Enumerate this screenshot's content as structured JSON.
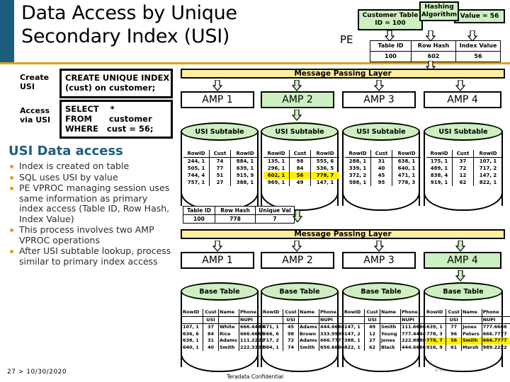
{
  "slide": {
    "title": "Data Access by Unique Secondary Index (USI)",
    "footer_number": "27",
    "footer_sep": ">",
    "footer_date": "10/30/2020",
    "confidential": "Teradata Confidential",
    "watermark": "Teradata",
    "watermark_sub": "a division of NCR"
  },
  "left": {
    "create_label_l1": "Create",
    "create_label_l2": "USI",
    "create_sql_l1": "CREATE UNIQUE INDEX",
    "create_sql_l2": "(cust) on customer;",
    "access_label_l1": "Access",
    "access_label_l2": "via USI",
    "access_sql_l1": "SELECT    *",
    "access_sql_l2": "FROM      customer",
    "access_sql_l3": "WHERE   cust = 56;",
    "heading": "USI Data access",
    "bullets": [
      "Index is created on table",
      "SQL uses USI by value",
      "PE VPROC managing session uses same information as primary index access (Table ID, Row Hash, Index Value)",
      "This process involves two AMP VPROC operations",
      "After USI subtable lookup, process similar to primary index access"
    ]
  },
  "pe": {
    "label": "PE",
    "customer_table_l1": "Customer Table",
    "customer_table_l2": "ID = 100",
    "hashing_l1": "Hashing",
    "hashing_l2": "Algorithm",
    "value_box": "Value = 56",
    "headers": [
      "Table ID",
      "Row Hash",
      "Index Value"
    ],
    "values": [
      "100",
      "602",
      "56"
    ]
  },
  "mpl": {
    "top_label": "Message Passing Layer",
    "bottom_label": "Message Passing Layer"
  },
  "amps_top": [
    {
      "label": "AMP 1",
      "highlighted": false
    },
    {
      "label": "AMP 2",
      "highlighted": true
    },
    {
      "label": "AMP 3",
      "highlighted": false
    },
    {
      "label": "AMP 4",
      "highlighted": false
    }
  ],
  "amps_bottom": [
    {
      "label": "AMP 1",
      "highlighted": false
    },
    {
      "label": "AMP 2",
      "highlighted": false
    },
    {
      "label": "AMP 3",
      "highlighted": false
    },
    {
      "label": "AMP 4",
      "highlighted": true
    }
  ],
  "usi_subtables": {
    "title": "USI Subtable",
    "headers": [
      "RowID",
      "Cust",
      "RowID"
    ],
    "amp1": [
      [
        "244, 1",
        "74",
        "884, 1"
      ],
      [
        "505, 1",
        "77",
        "639, 1"
      ],
      [
        "744, 4",
        "51",
        "915, 9"
      ],
      [
        "757, 1",
        "27",
        "388, 1"
      ]
    ],
    "amp2": [
      [
        "135, 1",
        "98",
        "555, 6"
      ],
      [
        "296, 1",
        "84",
        "536, 5"
      ],
      [
        "602, 1",
        "56",
        "778, 7"
      ],
      [
        "969, 1",
        "49",
        "147, 1"
      ]
    ],
    "amp2_highlight_row": 2,
    "amp3": [
      [
        "288, 1",
        "31",
        "638, 1"
      ],
      [
        "339, 1",
        "40",
        "640, 1"
      ],
      [
        "372, 2",
        "45",
        "471, 1"
      ],
      [
        "588, 1",
        "95",
        "778, 3"
      ]
    ],
    "amp4": [
      [
        "175, 1",
        "37",
        "107, 1"
      ],
      [
        "489, 1",
        "72",
        "717, 2"
      ],
      [
        "838, 4",
        "12",
        "147, 2"
      ],
      [
        "919, 1",
        "62",
        "822, 1"
      ]
    ]
  },
  "lookup_result": {
    "headers": [
      "Table ID",
      "Row Hash",
      "Unique Val"
    ],
    "values": [
      "100",
      "778",
      "7"
    ]
  },
  "base_tables": {
    "title": "Base Table",
    "headers": [
      "RowID",
      "Cust",
      "Name",
      "Phone"
    ],
    "subheaders": [
      "",
      "USI",
      "",
      "NUPI"
    ],
    "amp1": [
      [
        "107, 1",
        "37",
        "White",
        "666.4444"
      ],
      [
        "636, 6",
        "84",
        "Rice",
        "666.6666"
      ],
      [
        "638, 1",
        "31",
        "Adams",
        "111.2222"
      ],
      [
        "640, 1",
        "40",
        "Smith",
        "222.3333"
      ]
    ],
    "amp2": [
      [
        "471, 1",
        "45",
        "Adams",
        "444.6666"
      ],
      [
        "566, 6",
        "98",
        "Brown",
        "333.9999"
      ],
      [
        "717, 2",
        "72",
        "Adams",
        "666.7777"
      ],
      [
        "884, 1",
        "74",
        "Smith",
        "656.6666"
      ]
    ],
    "amp3": [
      [
        "147, 1",
        "49",
        "Smith",
        "111.6666"
      ],
      [
        "147, 2",
        "12",
        "Young",
        "777.4444"
      ],
      [
        "388, 1",
        "27",
        "Jones",
        "222.8888"
      ],
      [
        "822, 1",
        "62",
        "Black",
        "444.6666"
      ]
    ],
    "amp4": [
      [
        "639, 1",
        "77",
        "Jones",
        "777.6666"
      ],
      [
        "778, 3",
        "96",
        "Peters",
        "666.7777"
      ],
      [
        "778, 7",
        "56",
        "Smith",
        "666.7777"
      ],
      [
        "916, 9",
        "61",
        "Marsh",
        "989.2222"
      ]
    ],
    "amp4_highlight_row": 2
  },
  "colors": {
    "accent_blue": "#1b5e7e",
    "accent_gold": "#e3a012",
    "green_fill": "#cdf0c0",
    "yellow_mpl": "#ffef9e",
    "highlight": "#ffee00"
  }
}
